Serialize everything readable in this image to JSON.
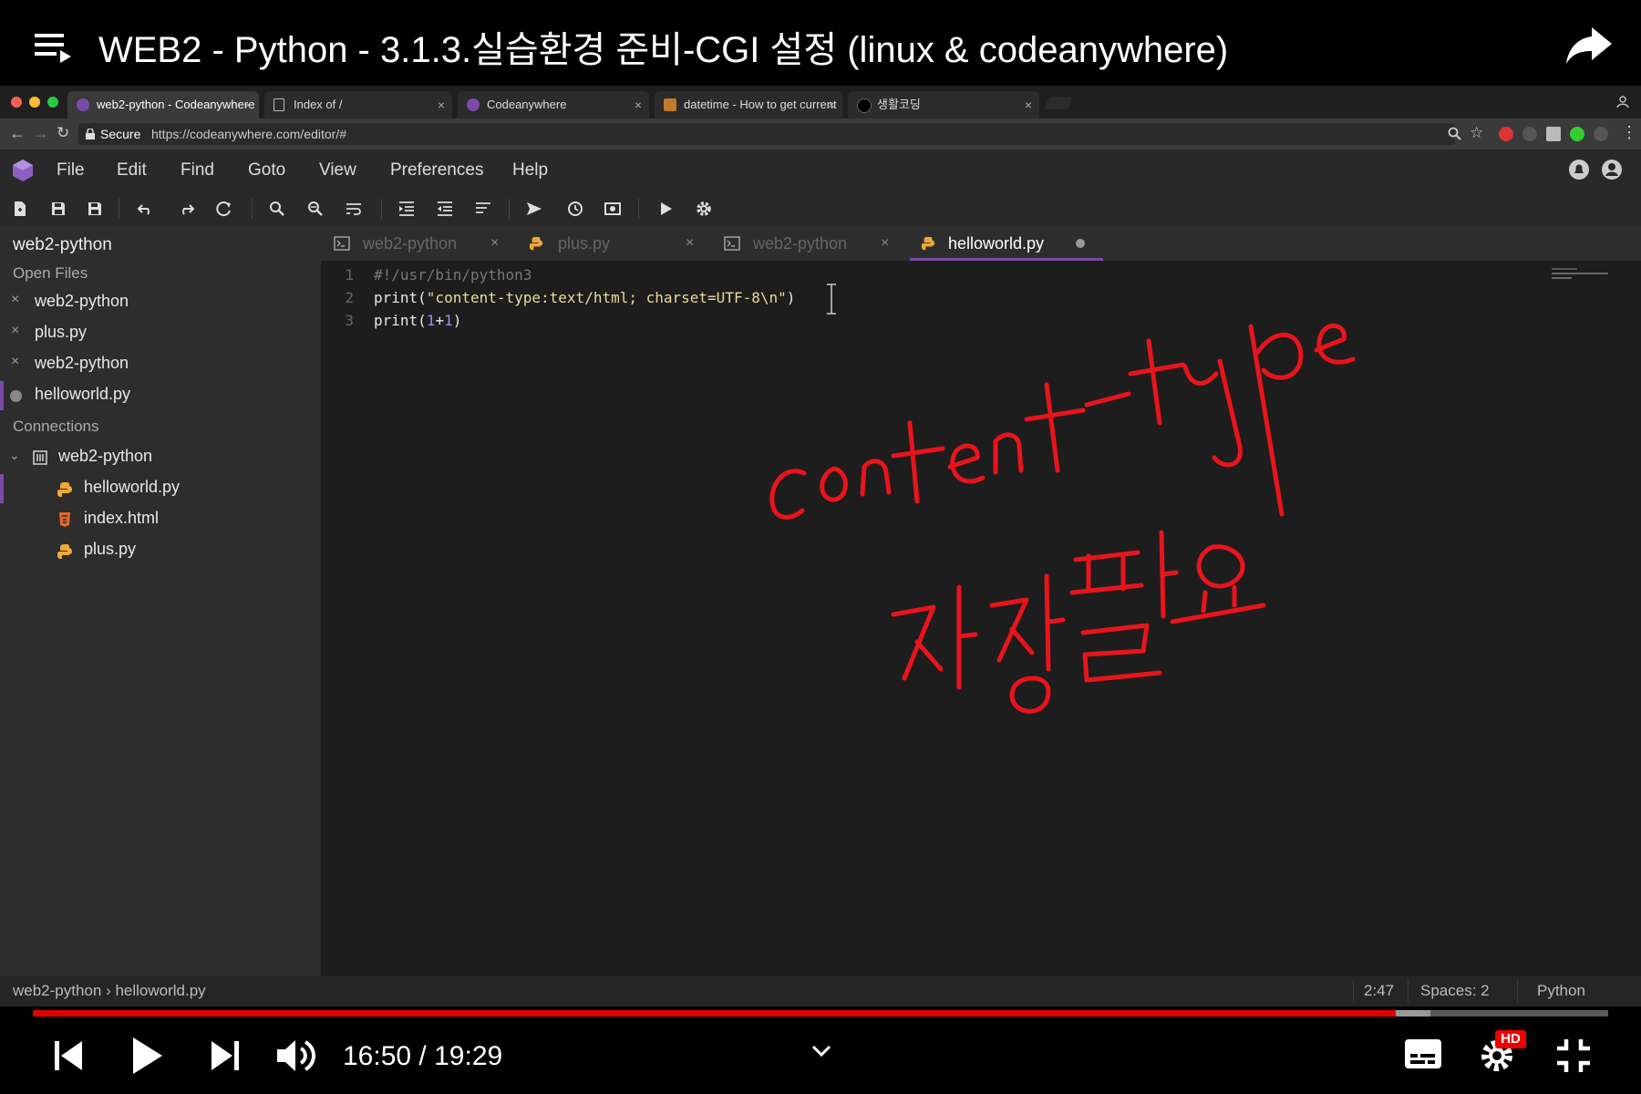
{
  "youtube": {
    "title": "WEB2 - Python - 3.1.3.실습환경 준비-CGI 설정 (linux & codeanywhere)",
    "time_current": "16:50",
    "time_total": "19:29",
    "time_separator": "/",
    "progress_fraction": 0.865,
    "buffered_fraction": 0.887,
    "hd_badge": "HD",
    "accent_color": "#e00000"
  },
  "browser": {
    "tabs": [
      {
        "label": "web2-python - Codeanywhere",
        "active": true
      },
      {
        "label": "Index of /",
        "active": false
      },
      {
        "label": "Codeanywhere",
        "active": false
      },
      {
        "label": "datetime - How to get current",
        "active": false
      },
      {
        "label": "생활코딩",
        "active": false
      }
    ],
    "secure_label": "Secure",
    "url": "https://codeanywhere.com/editor/#"
  },
  "editor": {
    "menu": [
      "File",
      "Edit",
      "Find",
      "Goto",
      "View",
      "Preferences",
      "Help"
    ],
    "sidebar": {
      "project": "web2-python",
      "open_files_heading": "Open Files",
      "open_files": [
        "web2-python",
        "plus.py",
        "web2-python",
        "helloworld.py"
      ],
      "connections_heading": "Connections",
      "connection": "web2-python",
      "tree": [
        "helloworld.py",
        "index.html",
        "plus.py"
      ]
    },
    "tabs": [
      {
        "label": "web2-python",
        "type": "terminal"
      },
      {
        "label": "plus.py",
        "type": "python"
      },
      {
        "label": "web2-python",
        "type": "terminal"
      },
      {
        "label": "helloworld.py",
        "type": "python",
        "active": true
      }
    ],
    "code": {
      "line_numbers": [
        "1",
        "2",
        "3"
      ],
      "line1": "#!/usr/bin/python3",
      "line2_fn": "print(",
      "line2_str": "\"content-type:text/html; charset=UTF-8\\n\"",
      "line2_end": ")",
      "line3_fn": "print(",
      "line3_a": "1",
      "line3_op": "+",
      "line3_b": "1",
      "line3_end": ")"
    },
    "status": {
      "breadcrumb": "web2-python › helloworld.py",
      "cursor": "2:47",
      "spaces": "Spaces: 2",
      "language": "Python"
    }
  },
  "annotation": {
    "handwriting_line1": "content-type",
    "handwriting_line2": "저장필요",
    "color": "#e8141c"
  }
}
